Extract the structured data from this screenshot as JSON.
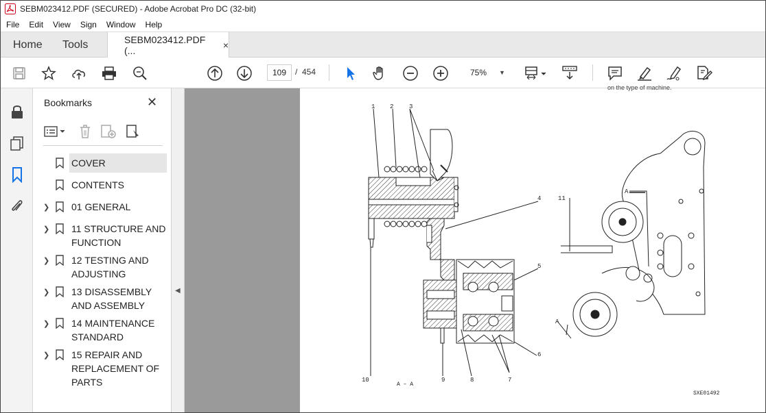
{
  "window": {
    "title": "SEBM023412.PDF (SECURED) - Adobe Acrobat Pro DC (32-bit)"
  },
  "menu": [
    "File",
    "Edit",
    "View",
    "Sign",
    "Window",
    "Help"
  ],
  "tabs": {
    "home": "Home",
    "tools": "Tools",
    "document": "SEBM023412.PDF (...",
    "close": "×"
  },
  "toolbar": {
    "page_current": "109",
    "page_separator": "/",
    "page_total": "454",
    "zoom": "75%",
    "icons": [
      "save-icon",
      "bookmark-star-icon",
      "upload-icon",
      "print-icon",
      "zoom-search-icon",
      "prev-page-icon",
      "next-page-icon",
      "select-cursor-icon",
      "hand-icon",
      "zoom-out-icon",
      "zoom-in-icon",
      "page-fit-icon",
      "scroll-mode-icon",
      "comment-icon",
      "highlight-icon",
      "sign-icon",
      "edit-pdf-icon"
    ]
  },
  "bookmarks": {
    "title": "Bookmarks",
    "close": "✕",
    "items": [
      {
        "label": "COVER",
        "expandable": false,
        "selected": true
      },
      {
        "label": "CONTENTS",
        "expandable": false,
        "selected": false
      },
      {
        "label": "01 GENERAL",
        "expandable": true,
        "selected": false
      },
      {
        "label": "11 STRUCTURE AND FUNCTION",
        "expandable": true,
        "selected": false
      },
      {
        "label": "12 TESTING AND ADJUSTING",
        "expandable": true,
        "selected": false
      },
      {
        "label": "13 DISASSEMBLY AND ASSEMBLY",
        "expandable": true,
        "selected": false
      },
      {
        "label": "14 MAINTENANCE STANDARD",
        "expandable": true,
        "selected": false
      },
      {
        "label": "15 REPAIR AND REPLACEMENT OF PARTS",
        "expandable": true,
        "selected": false
      }
    ]
  },
  "page": {
    "cutoff_text": "on the type of machine.",
    "section_caption": "A – A",
    "figure_code": "SXE01492",
    "callouts": [
      "1",
      "2",
      "3",
      "4",
      "5",
      "6",
      "7",
      "8",
      "9",
      "10",
      "11",
      "A",
      "A"
    ]
  },
  "colors": {
    "accent_blue": "#1473e6",
    "highlight": "#e6e6e6",
    "doc_bg": "#9a9a9a"
  }
}
